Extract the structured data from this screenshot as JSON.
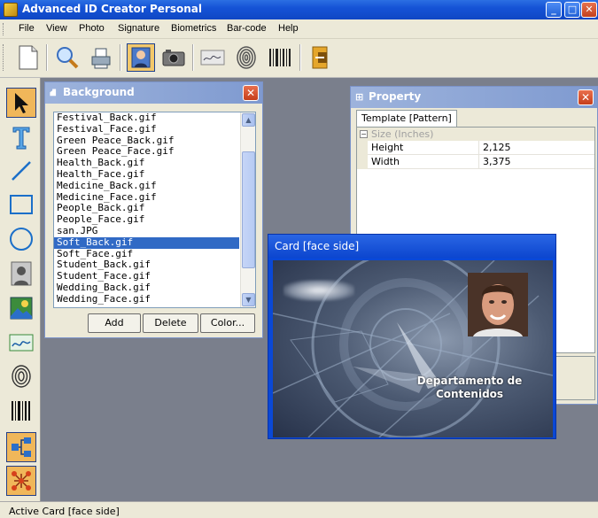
{
  "window": {
    "title": "Advanced ID Creator Personal"
  },
  "menu": [
    "File",
    "View",
    "Photo",
    "Signature",
    "Biometrics",
    "Bar-code",
    "Help"
  ],
  "background_panel": {
    "title": "Background",
    "files": [
      "Festival_Back.gif",
      "Festival_Face.gif",
      "Green Peace_Back.gif",
      "Green Peace_Face.gif",
      "Health_Back.gif",
      "Health_Face.gif",
      "Medicine_Back.gif",
      "Medicine_Face.gif",
      "People_Back.gif",
      "People_Face.gif",
      "san.JPG",
      "Soft_Back.gif",
      "Soft_Face.gif",
      "Student_Back.gif",
      "Student_Face.gif",
      "Wedding_Back.gif",
      "Wedding_Face.gif"
    ],
    "selected": "Soft_Back.gif",
    "buttons": {
      "add": "Add",
      "delete": "Delete",
      "color": "Color..."
    }
  },
  "property_panel": {
    "title": "Property",
    "tab": "Template [Pattern]",
    "category": "Size (Inches)",
    "rows": [
      {
        "name": "Height",
        "value": "2,125"
      },
      {
        "name": "Width",
        "value": "3,375"
      }
    ]
  },
  "card_window": {
    "title": "Card [face side]",
    "department": "Departamento de Contenidos"
  },
  "status": {
    "text": "Active Card [face side]"
  }
}
